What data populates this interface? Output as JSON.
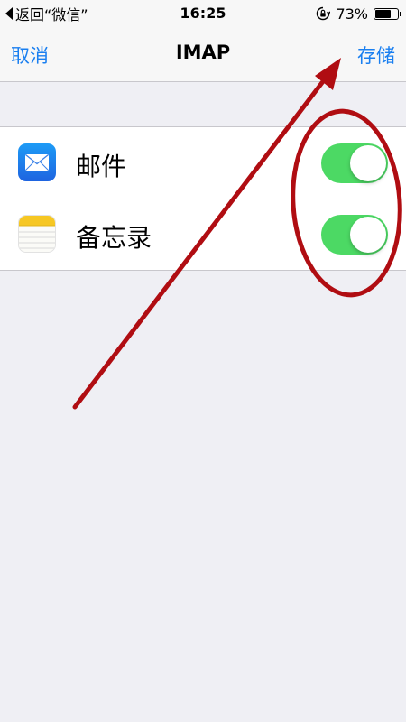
{
  "status_bar": {
    "back_text": "返回“微信”",
    "time": "16:25",
    "battery_percent": "73%",
    "battery_level": 0.73
  },
  "nav": {
    "cancel_label": "取消",
    "title": "IMAP",
    "save_label": "存储"
  },
  "items": [
    {
      "label": "邮件",
      "icon": "mail-app-icon",
      "enabled": true
    },
    {
      "label": "备忘录",
      "icon": "notes-app-icon",
      "enabled": true
    }
  ],
  "colors": {
    "accent": "#1a7ff0",
    "toggle_on": "#4cd964",
    "annotation": "#b00d12"
  }
}
